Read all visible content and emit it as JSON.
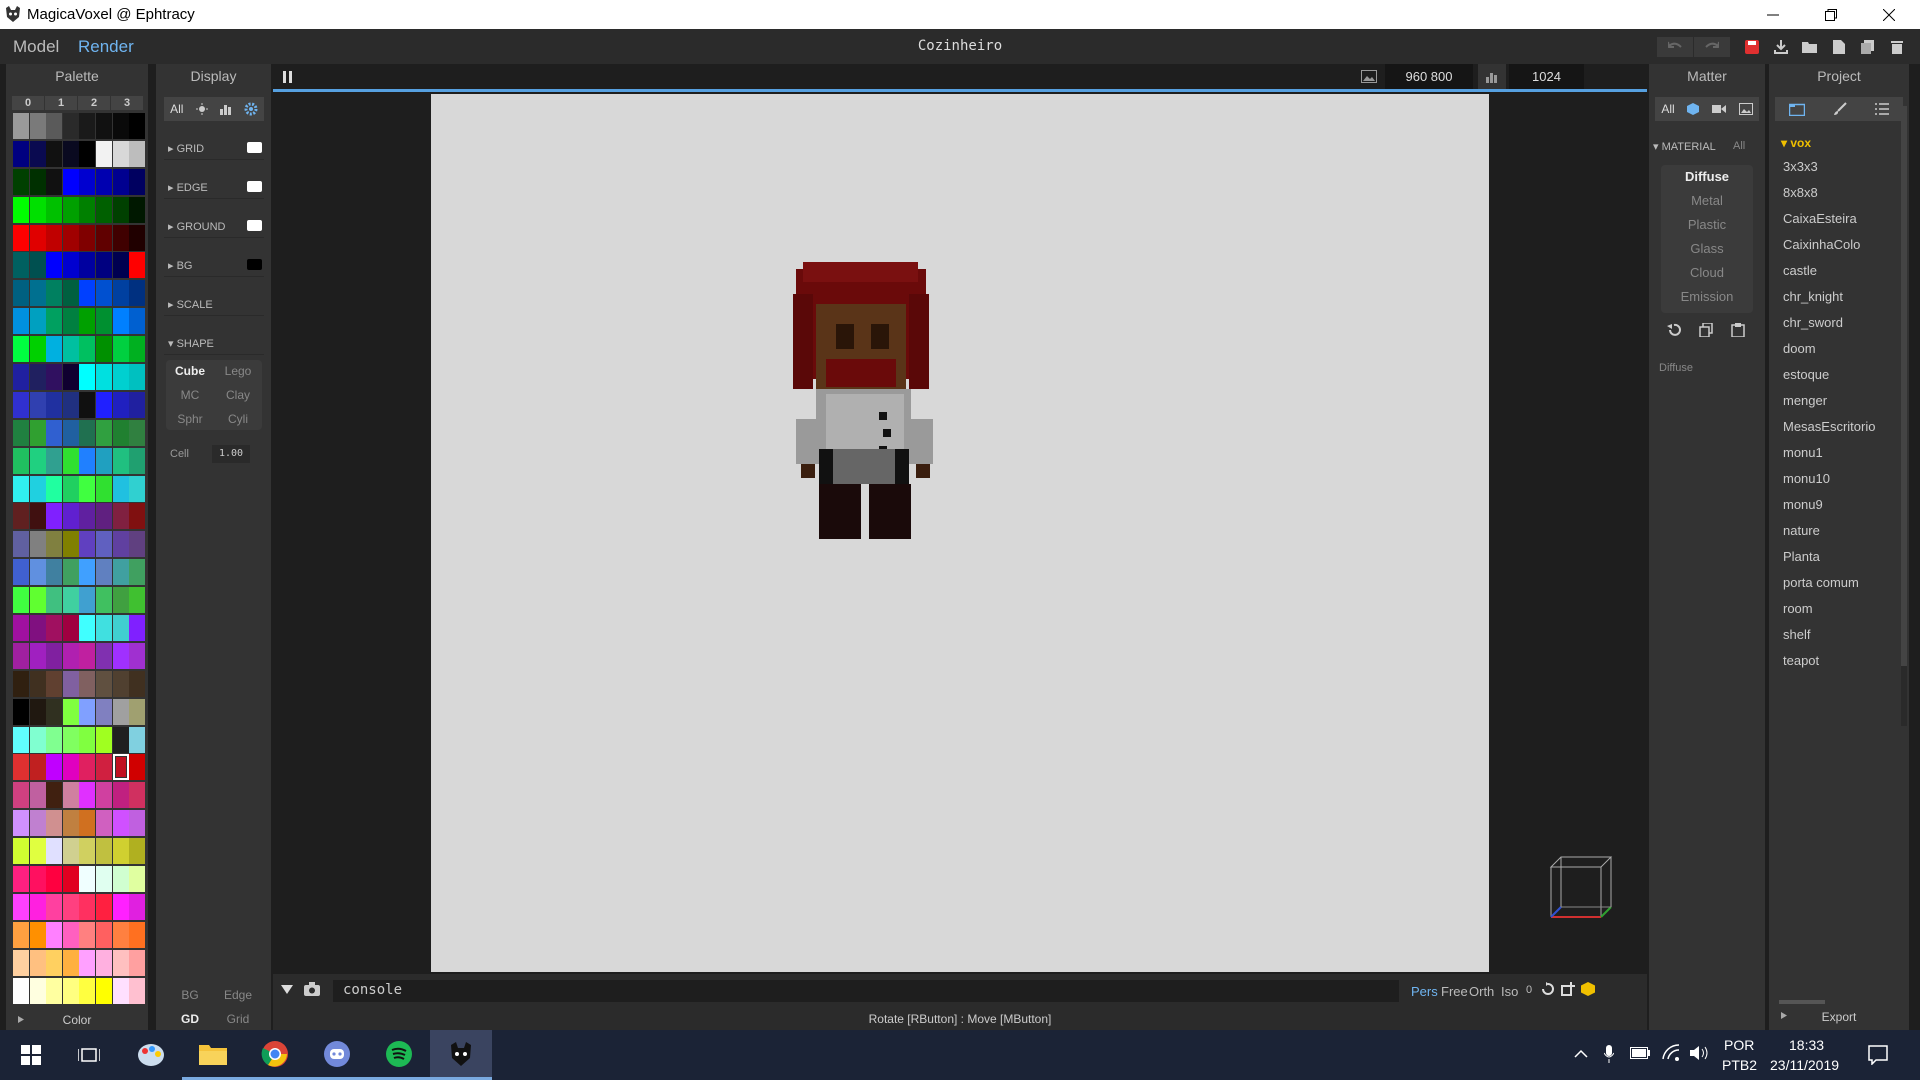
{
  "window": {
    "title": "MagicaVoxel @ Ephtracy"
  },
  "modes": {
    "model": "Model",
    "render": "Render"
  },
  "project_title": "Cozinheiro",
  "palette": {
    "title": "Palette",
    "tabs": [
      "0",
      "1",
      "2",
      "3"
    ],
    "footer": "Color",
    "colors": [
      "#9a9a9a",
      "#7a7a7a",
      "#5a5a5a",
      "#2a2a2a",
      "#1a1a1a",
      "#111",
      "#0a0a0a",
      "#000",
      "#000080",
      "#0a0a50",
      "#111",
      "#0a0a20",
      "#000",
      "#f2f2f2",
      "#d8d8d8",
      "#bdbdbd",
      "#004000",
      "#003000",
      "#111",
      "#0000ff",
      "#0000d0",
      "#0000b0",
      "#000090",
      "#000060",
      "#00ff00",
      "#00e000",
      "#00c000",
      "#00a000",
      "#008000",
      "#006000",
      "#004000",
      "#001800",
      "#ff0000",
      "#e00000",
      "#c00000",
      "#a00000",
      "#800000",
      "#600000",
      "#400000",
      "#200000",
      "#006060",
      "#005050",
      "#0000ff",
      "#0000d0",
      "#0000a0",
      "#000080",
      "#000050",
      "#ff0000",
      "#006080",
      "#007090",
      "#008060",
      "#006040",
      "#0040ff",
      "#0050d0",
      "#0040a0",
      "#003080",
      "#0090e0",
      "#00a0c0",
      "#00a060",
      "#008040",
      "#00a000",
      "#009030",
      "#0080ff",
      "#0060d0",
      "#00ff40",
      "#00d000",
      "#00b0e0",
      "#00c0a0",
      "#00c060",
      "#009000",
      "#00d040",
      "#00b020",
      "#2020a0",
      "#202060",
      "#301060",
      "#100030",
      "#00ffff",
      "#00e0e0",
      "#00d0d0",
      "#00c0c0",
      "#3030d0",
      "#3040b0",
      "#2030a0",
      "#203080",
      "#101010",
      "#2020ff",
      "#2020c0",
      "#2020a0",
      "#208040",
      "#30a030",
      "#3060d0",
      "#2060a0",
      "#207050",
      "#30a040",
      "#208030",
      "#308040",
      "#20c060",
      "#20d080",
      "#30a090",
      "#30e030",
      "#2080ff",
      "#20a0c0",
      "#20c080",
      "#20a070",
      "#30f0f0",
      "#20d0e0",
      "#20ffa0",
      "#20d060",
      "#40ff40",
      "#30e030",
      "#20c0e0",
      "#30d0d0",
      "#602020",
      "#401010",
      "#8020ff",
      "#6020d0",
      "#6020a0",
      "#602080",
      "#802040",
      "#801010",
      "#6060a0",
      "#808080",
      "#808040",
      "#808000",
      "#6040c0",
      "#6060c0",
      "#6040a0",
      "#604080",
      "#4060d0",
      "#6090e0",
      "#4080a0",
      "#40a060",
      "#40a0ff",
      "#6080c0",
      "#40a0a0",
      "#40a060",
      "#40ff40",
      "#60ff30",
      "#40c080",
      "#40d0a0",
      "#40a0d0",
      "#40c060",
      "#40a040",
      "#40c030",
      "#a010a0",
      "#801080",
      "#a01060",
      "#a00040",
      "#40ffff",
      "#40e0e0",
      "#40d0d0",
      "#8020ff",
      "#a020a0",
      "#a020c0",
      "#8020a0",
      "#b020b0",
      "#c020a0",
      "#8030b0",
      "#a030ff",
      "#a030d0",
      "#302010",
      "#403020",
      "#604030",
      "#8060a0",
      "#806060",
      "#605040",
      "#504030",
      "#403020",
      "#000",
      "#201810",
      "#303020",
      "#80ff40",
      "#80a0ff",
      "#8080c0",
      "#a0a0a0",
      "#a0a070",
      "#60ffff",
      "#80ffd0",
      "#80ff90",
      "#80ff60",
      "#80ff40",
      "#a0ff20",
      "#202020",
      "#80d0e0",
      "#e03030",
      "#c02020",
      "#c000ff",
      "#e000c0",
      "#e02060",
      "#d02040",
      "#c01020",
      "#d00000",
      "#d04080",
      "#c060a0",
      "#402010",
      "#d080a0",
      "#e030ff",
      "#d040a0",
      "#c02080",
      "#d03060",
      "#d090ff",
      "#c080d0",
      "#d09090",
      "#c08040",
      "#d07020",
      "#d060c0",
      "#d050ff",
      "#c060e0",
      "#d0ff30",
      "#e0ff40",
      "#e0e0ff",
      "#d0d090",
      "#d0d060",
      "#c0c040",
      "#d0d030",
      "#b0b020",
      "#ff2080",
      "#ff1060",
      "#ff0040",
      "#e00020",
      "#f0ffff",
      "#e0fff0",
      "#d0ffd0",
      "#e0ffa0",
      "#ff40ff",
      "#ff20e0",
      "#ff40a0",
      "#ff4080",
      "#ff3060",
      "#ff2040",
      "#ff20ff",
      "#e020e0",
      "#ffa040",
      "#ff9000",
      "#ff80ff",
      "#ff60c0",
      "#ff8080",
      "#ff6060",
      "#ff8040",
      "#ff7020",
      "#ffd0a0",
      "#ffc080",
      "#ffd060",
      "#ffb040",
      "#ffa0ff",
      "#ffb0e0",
      "#ffc0c0",
      "#ffa0a0",
      "#ffffff",
      "#ffffe0",
      "#ffffa0",
      "#ffff80",
      "#ffff40",
      "#ffff00",
      "#ffe0ff",
      "#ffc0d0"
    ],
    "selected_index": 190
  },
  "display": {
    "title": "Display",
    "filter_all": "All",
    "rows": [
      {
        "label": "GRID",
        "color": "#ffffff"
      },
      {
        "label": "EDGE",
        "color": "#ffffff"
      },
      {
        "label": "GROUND",
        "color": "#ffffff"
      },
      {
        "label": "BG",
        "color": "#000000"
      },
      {
        "label": "SCALE"
      },
      {
        "label": "SHAPE"
      }
    ],
    "shapes": [
      "Cube",
      "Lego",
      "MC",
      "Clay",
      "Sphr",
      "Cyli"
    ],
    "cell_label": "Cell",
    "cell_value": "1.00",
    "footer": [
      "BG",
      "Edge",
      "GD",
      "Grid"
    ]
  },
  "viewport": {
    "resolution": "960  800",
    "samples": "1024",
    "console_text": "console",
    "view_options": [
      "Pers",
      "Free",
      "Orth",
      "Iso",
      "0"
    ],
    "status": "Rotate [RButton] : Move [MButton]"
  },
  "matter": {
    "title": "Matter",
    "filter_all": "All",
    "material_header": "MATERIAL",
    "material_all": "All",
    "materials": [
      "Diffuse",
      "Metal",
      "Plastic",
      "Glass",
      "Cloud",
      "Emission"
    ],
    "selected_material": "Diffuse",
    "footer_label": "Diffuse"
  },
  "project": {
    "title": "Project",
    "folder": "vox",
    "files": [
      "3x3x3",
      "8x8x8",
      "CaixaEsteira",
      "CaixinhaColo",
      "castle",
      "chr_knight",
      "chr_sword",
      "doom",
      "estoque",
      "menger",
      "MesasEscritorio",
      "monu1",
      "monu10",
      "monu9",
      "nature",
      "Planta",
      "porta comum",
      "room",
      "shelf",
      "teapot"
    ],
    "export": "Export"
  },
  "taskbar": {
    "lang": "POR",
    "layout": "PTB2",
    "time": "18:33",
    "date": "23/11/2019"
  },
  "colors": {
    "accent": "#56a0e0",
    "folder": "#f0c000",
    "bg": "#2b2b2b"
  }
}
